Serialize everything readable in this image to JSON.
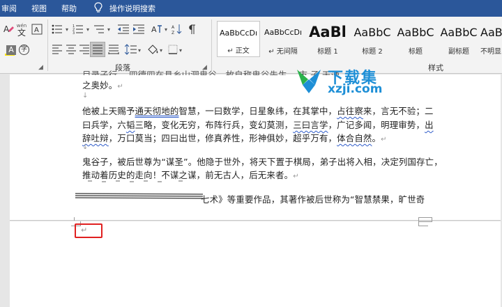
{
  "menu": {
    "items": [
      "审阅",
      "视图",
      "帮助"
    ],
    "search_label": "操作说明搜索"
  },
  "ribbon": {
    "font_group": {
      "wen_glyph": "wén",
      "wen_char": "文",
      "a_label": "A",
      "zi_label": "字"
    },
    "paragraph_group": {
      "label": "段落"
    },
    "styles_group": {
      "label": "样式",
      "items": [
        {
          "sample": "AaBbCcDı",
          "name": "↵ 正文"
        },
        {
          "sample": "AaBbCcDı",
          "name": "↵ 无间隔"
        },
        {
          "sample": "AaBl",
          "name": "标题 1"
        },
        {
          "sample": "AaBbC",
          "name": "标题 2"
        },
        {
          "sample": "AaBbC",
          "name": "标题"
        },
        {
          "sample": "AaBbC",
          "name": "副标题"
        },
        {
          "sample": "AaBbC",
          "name": "不明显"
        }
      ]
    }
  },
  "document": {
    "line1": "目录子行。 四德四在县乡山洞鬼谷，故自称鬼谷先生。 市 子 天通",
    "line1b": "之奥妙。",
    "line2_parts": [
      "他被上天赐予",
      "通天彻地的",
      "智慧，一曰数学，日星象纬，在其掌中，",
      "占往察",
      "来，言无不验；二"
    ],
    "line3_parts": [
      "曰兵学，六",
      "韬",
      "三略，变化无穷，布阵行兵，变幻莫测，",
      "三曰言学",
      "，广记多闻，明理审势，",
      "出"
    ],
    "line4_parts": [
      "辞吐辩",
      "，万口莫当；四曰出世，修真养性，形神俱妙，超乎万有，",
      "体合自然",
      "。"
    ],
    "line5": "鬼谷子，被后世尊为“谋圣”。他隐于世外，将天下置于棋局，弟子出将入相，决定列国存亡，",
    "line6": "推动着历史的走向！不谋之谋，前无古人，后无来者。",
    "line7": "七术》等重要作品，其著作被后世称为“智慧禁果，旷世奇",
    "para_mark": "↵",
    "arrow_mark": "↓"
  },
  "watermark": {
    "title": "下载集",
    "url": "xzji.com"
  },
  "colors": {
    "title_bar": "#2b579a",
    "watermark": "#1e8fd6",
    "highlight_box": "#e02020"
  }
}
